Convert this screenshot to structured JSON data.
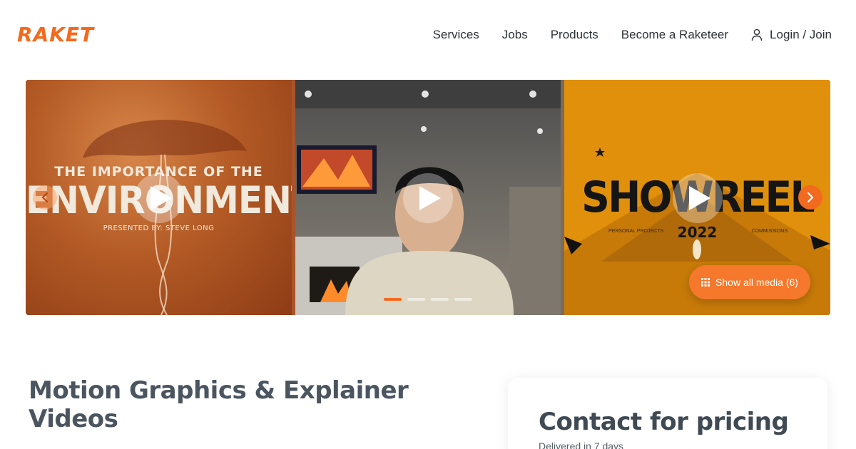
{
  "header": {
    "logo": "RAKET",
    "nav": {
      "services": "Services",
      "jobs": "Jobs",
      "products": "Products",
      "become": "Become a Raketeer",
      "login": "Login / Join"
    }
  },
  "carousel": {
    "slides": [
      {
        "kind": "video",
        "subtitle": "THE IMPORTANCE OF THE",
        "title": "ENVIRONMENT",
        "byline": "PRESENTED BY: STEVE LONG"
      },
      {
        "kind": "video"
      },
      {
        "kind": "video",
        "title": "SHOWREEL",
        "year": "2022",
        "left_caption": "PERSONAL PROJECTS",
        "right_caption": "COMMISSIONS"
      }
    ],
    "dot_count": 4,
    "active_dot": 0,
    "show_all_label": "Show all media (6)"
  },
  "service": {
    "title": "Motion Graphics & Explainer Videos"
  },
  "pricing": {
    "title": "Contact for pricing",
    "delivery": "Delivered in 7 days"
  },
  "colors": {
    "accent": "#f26a1e",
    "text": "#3f4a54"
  },
  "icons": [
    "user-icon",
    "play-icon",
    "chevron-left-icon",
    "chevron-right-icon",
    "grid-icon"
  ]
}
